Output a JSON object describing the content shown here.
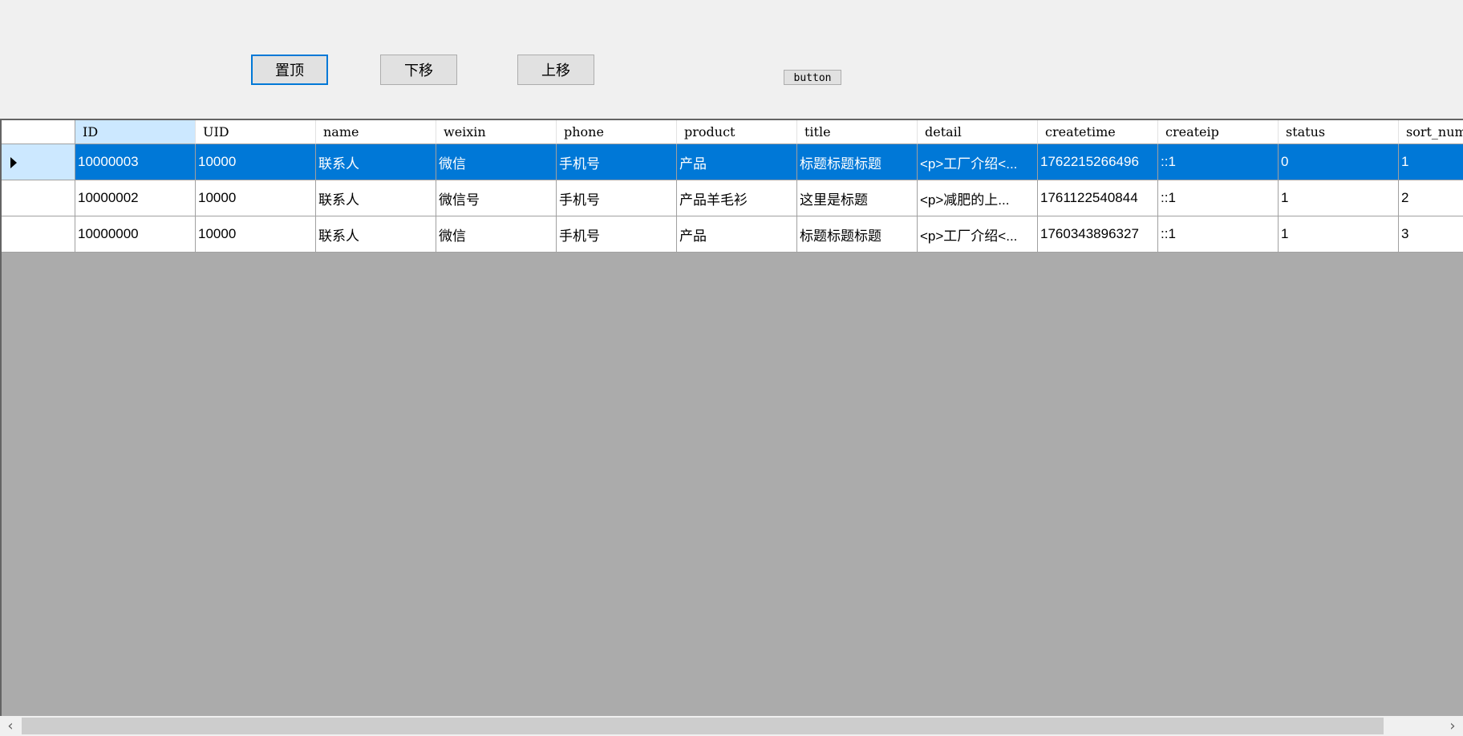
{
  "toolbar": {
    "pin_top_label": "置顶",
    "move_down_label": "下移",
    "move_up_label": "上移",
    "extra_button_label": "button"
  },
  "grid": {
    "columns": [
      "ID",
      "UID",
      "name",
      "weixin",
      "phone",
      "product",
      "title",
      "detail",
      "createtime",
      "createip",
      "status",
      "sort_num"
    ],
    "rows": [
      [
        "10000003",
        "10000",
        "联系人",
        "微信",
        "手机号",
        "产品",
        "标题标题标题",
        "<p>工厂介绍<...",
        "1762215266496",
        "::1",
        "0",
        "1"
      ],
      [
        "10000002",
        "10000",
        "联系人",
        "微信号",
        "手机号",
        "产品羊毛衫",
        "这里是标题",
        "<p>减肥的上...",
        "1761122540844",
        "::1",
        "1",
        "2"
      ],
      [
        "10000000",
        "10000",
        "联系人",
        "微信",
        "手机号",
        "产品",
        "标题标题标题",
        "<p>工厂介绍<...",
        "1760343896327",
        "::1",
        "1",
        "3"
      ]
    ],
    "selected_row": 0,
    "selected_column": 0
  },
  "colors": {
    "selection": "#0078d7",
    "header_selection": "#cce8ff",
    "grid_background": "#ababab"
  }
}
